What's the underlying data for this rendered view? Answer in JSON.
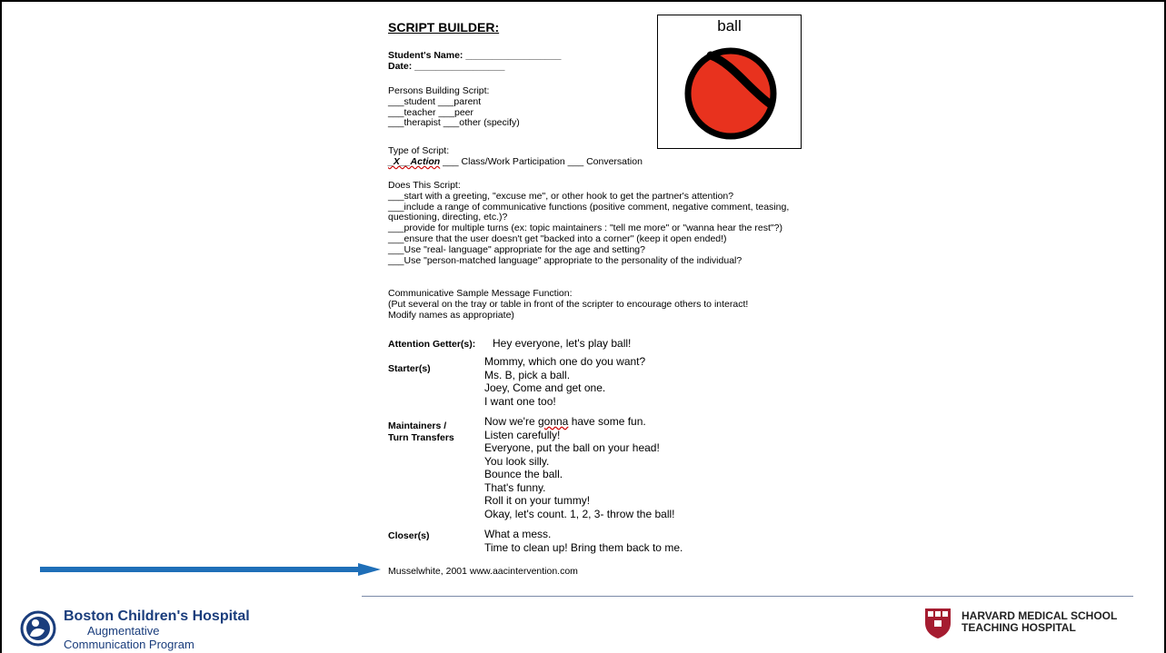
{
  "document": {
    "title": "SCRIPT BUILDER:",
    "student_name": "Student's Name: __________________",
    "date": "Date: _________________",
    "persons_heading": "Persons Building Script:",
    "persons_lines": [
      "___student ___parent",
      "___teacher ___peer",
      "___therapist ___other (specify)"
    ],
    "type_heading": "Type of Script:",
    "type_selected": "_X__Action",
    "type_rest": " ___ Class/Work Participation ___ Conversation",
    "does_heading": "Does This Script:",
    "does_lines": [
      "___start with a greeting, \"excuse me\", or other hook to get the partner's attention?",
      "___include a range of communicative functions (positive comment, negative comment, teasing,",
      "questioning, directing, etc.)?",
      "___provide for multiple turns (ex: topic maintainers : \"tell me more\" or \"wanna hear the rest\"?)",
      "___ensure that the user doesn't get \"backed into a corner\" (keep it open ended!)",
      "___Use \"real- language\" appropriate for the age and setting?",
      "___Use \"person-matched language\" appropriate to the personality of the individual?"
    ],
    "sample_heading": [
      "Communicative Sample Message Function:",
      "(Put several on the tray or table in front of the scripter to encourage others to interact!",
      "Modify names as appropriate)"
    ],
    "attention_label": "Attention Getter(s):",
    "attention_text": "Hey everyone, let's play ball!",
    "starter_label": "Starter(s)",
    "starter_lines": [
      "Mommy, which one do you want?",
      "Ms. B, pick a ball.",
      "Joey, Come and get one.",
      "I want one too!"
    ],
    "maintainers_label": [
      "Maintainers /",
      "Turn Transfers"
    ],
    "maintainers_lines": [
      "Now we're gonna have some fun.",
      "Listen carefully!",
      "Everyone, put the ball on your head!",
      "You look silly.",
      "Bounce the ball.",
      "That's funny.",
      "Roll it on your tummy!",
      "Okay, let's count.  1, 2, 3- throw the ball!"
    ],
    "closer_label": "Closer(s)",
    "closer_lines": [
      "What a mess.",
      "Time to clean up!  Bring them back to me."
    ],
    "citation": "Musselwhite, 2001 www.aacintervention.com"
  },
  "picture_card": {
    "label": "ball",
    "ball_color": "#e8321e"
  },
  "footer": {
    "bch_name": "Boston Children's Hospital",
    "bch_sub1": "Augmentative",
    "bch_sub2": "Communication Program",
    "hms_line1": "HARVARD MEDICAL SCHOOL",
    "hms_line2": "TEACHING HOSPITAL",
    "arrow_color": "#1f6fb8",
    "brand_color": "#1a3d7c",
    "hms_shield_color": "#a51c30"
  }
}
